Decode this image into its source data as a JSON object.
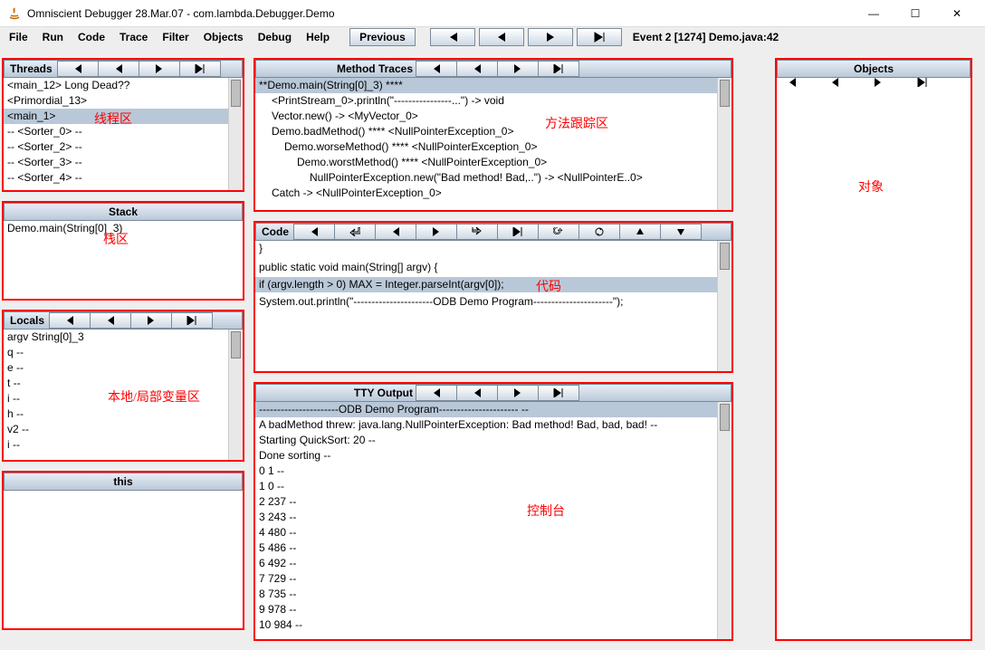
{
  "window": {
    "title": "Omniscient Debugger 28.Mar.07 - com.lambda.Debugger.Demo",
    "min": "—",
    "max": "☐",
    "close": "✕"
  },
  "menu": {
    "items": [
      "File",
      "Run",
      "Code",
      "Trace",
      "Filter",
      "Objects",
      "Debug",
      "Help"
    ],
    "previous": "Previous",
    "event": "Event   2 [1274]  Demo.java:42"
  },
  "threads": {
    "title": "Threads",
    "rows": [
      {
        "t": "<main_12>        Long Dead??",
        "sel": false
      },
      {
        "t": "<Primordial_13>",
        "sel": false
      },
      {
        "t": "<main_1>",
        "sel": true
      },
      {
        "t": "-- <Sorter_0> --",
        "sel": false
      },
      {
        "t": "-- <Sorter_2> --",
        "sel": false
      },
      {
        "t": "-- <Sorter_3> --",
        "sel": false
      },
      {
        "t": "-- <Sorter_4> --",
        "sel": false
      }
    ],
    "label": "线程区"
  },
  "stack": {
    "title": "Stack",
    "rows": [
      {
        "t": "Demo.main(String[0]_3)",
        "sel": false
      }
    ],
    "label": "栈区"
  },
  "locals": {
    "title": "Locals",
    "rows": [
      {
        "t": "argv      String[0]_3",
        "sel": false
      },
      {
        "t": "q         --",
        "sel": false
      },
      {
        "t": "e         --",
        "sel": false
      },
      {
        "t": "t          --",
        "sel": false
      },
      {
        "t": "i          --",
        "sel": false
      },
      {
        "t": "h         --",
        "sel": false
      },
      {
        "t": "v2        --",
        "sel": false
      },
      {
        "t": "i          --",
        "sel": false
      }
    ],
    "label": "本地/局部变量区"
  },
  "this": {
    "title": "this"
  },
  "traces": {
    "title": "Method Traces",
    "rows": [
      {
        "t": "**Demo.main(String[0]_3) ****",
        "sel": true,
        "pad": 0
      },
      {
        "t": "<PrintStream_0>.println(\"----------------...\") -> void",
        "sel": false,
        "pad": 1
      },
      {
        "t": "Vector.new() -> <MyVector_0>",
        "sel": false,
        "pad": 1
      },
      {
        "t": "Demo.badMethod() **** <NullPointerException_0>",
        "sel": false,
        "pad": 1
      },
      {
        "t": "Demo.worseMethod() **** <NullPointerException_0>",
        "sel": false,
        "pad": 2
      },
      {
        "t": "Demo.worstMethod() **** <NullPointerException_0>",
        "sel": false,
        "pad": 3
      },
      {
        "t": "NullPointerException.new(\"Bad method! Bad,..\") -> <NullPointerE..0>",
        "sel": false,
        "pad": 4
      },
      {
        "t": "Catch -> <NullPointerException_0>",
        "sel": false,
        "pad": 1
      }
    ],
    "label": "方法跟踪区"
  },
  "code": {
    "title": "Code",
    "rows": [
      {
        "t": "   }",
        "sel": false
      },
      {
        "t": "",
        "sel": false
      },
      {
        "t": "",
        "sel": false
      },
      {
        "t": "   public static void main(String[] argv) {",
        "sel": false
      },
      {
        "t": "",
        "sel": false
      },
      {
        "t": "      if (argv.length > 0) MAX = Integer.parseInt(argv[0]);",
        "sel": true
      },
      {
        "t": "",
        "sel": false
      },
      {
        "t": "      System.out.println(\"----------------------ODB Demo Program----------------------\");",
        "sel": false
      }
    ],
    "label": "代码"
  },
  "tty": {
    "title": "TTY Output",
    "rows": [
      {
        "t": "----------------------ODB Demo Program---------------------- --",
        "sel": true
      },
      {
        "t": "A badMethod threw: java.lang.NullPointerException: Bad method! Bad, bad, bad! --",
        "sel": false
      },
      {
        "t": "Starting QuickSort: 20 --",
        "sel": false
      },
      {
        "t": "Done sorting --",
        "sel": false
      },
      {
        "t": "0 1 --",
        "sel": false
      },
      {
        "t": "1 0 --",
        "sel": false
      },
      {
        "t": "2 237 --",
        "sel": false
      },
      {
        "t": "3 243 --",
        "sel": false
      },
      {
        "t": "4 480 --",
        "sel": false
      },
      {
        "t": "5 486 --",
        "sel": false
      },
      {
        "t": "6 492 --",
        "sel": false
      },
      {
        "t": "7 729 --",
        "sel": false
      },
      {
        "t": "8 735 --",
        "sel": false
      },
      {
        "t": "9 978 --",
        "sel": false
      },
      {
        "t": "10 984 --",
        "sel": false
      }
    ],
    "label": "控制台"
  },
  "objects": {
    "title": "Objects",
    "label": "对象"
  }
}
